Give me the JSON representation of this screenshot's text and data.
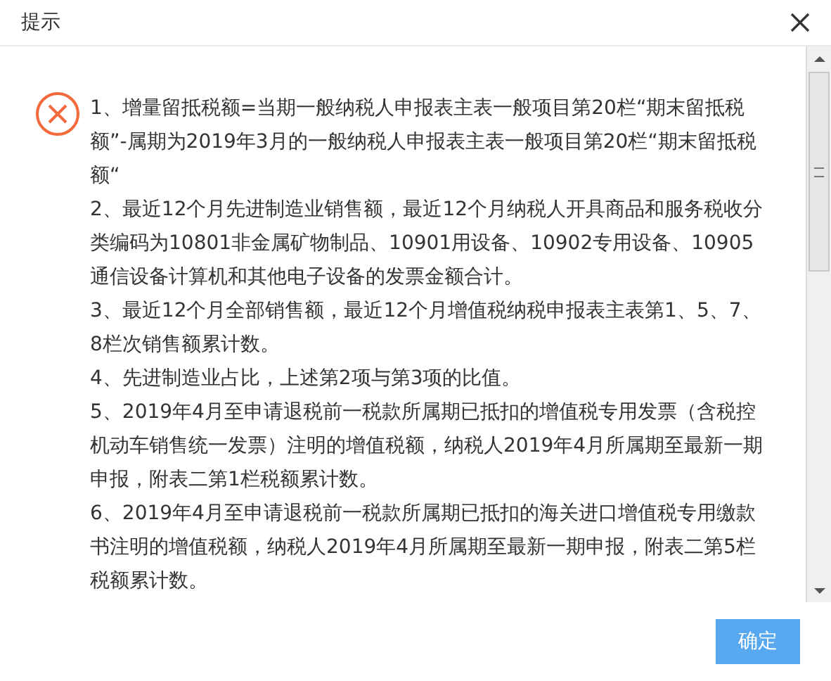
{
  "dialog": {
    "title": "提示"
  },
  "message": {
    "kind": "error",
    "paragraphs": [
      "1、增量留抵税额=当期一般纳税人申报表主表一般项目第20栏“期末留抵税额”-属期为2019年3月的一般纳税人申报表主表一般项目第20栏“期末留抵税额“",
      "2、最近12个月先进制造业销售额，最近12个月纳税人开具商品和服务税收分类编码为10801非金属矿物制品、10901用设备、10902专用设备、10905通信设备计算机和其他电子设备的发票金额合计。",
      "3、最近12个月全部销售额，最近12个月增值税纳税申报表主表第1、5、7、8栏次销售额累计数。",
      "4、先进制造业占比，上述第2项与第3项的比值。",
      "5、2019年4月至申请退税前一税款所属期已抵扣的增值税专用发票（含税控机动车销售统一发票）注明的增值税额，纳税人2019年4月所属期至最新一期申报，附表二第1栏税额累计数。",
      "6、2019年4月至申请退税前一税款所属期已抵扣的海关进口增值税专用缴款书注明的增值税额，纳税人2019年4月所属期至最新一期申报，附表二第5栏税额累计数。"
    ]
  },
  "buttons": [
    {
      "label": "确定"
    }
  ]
}
